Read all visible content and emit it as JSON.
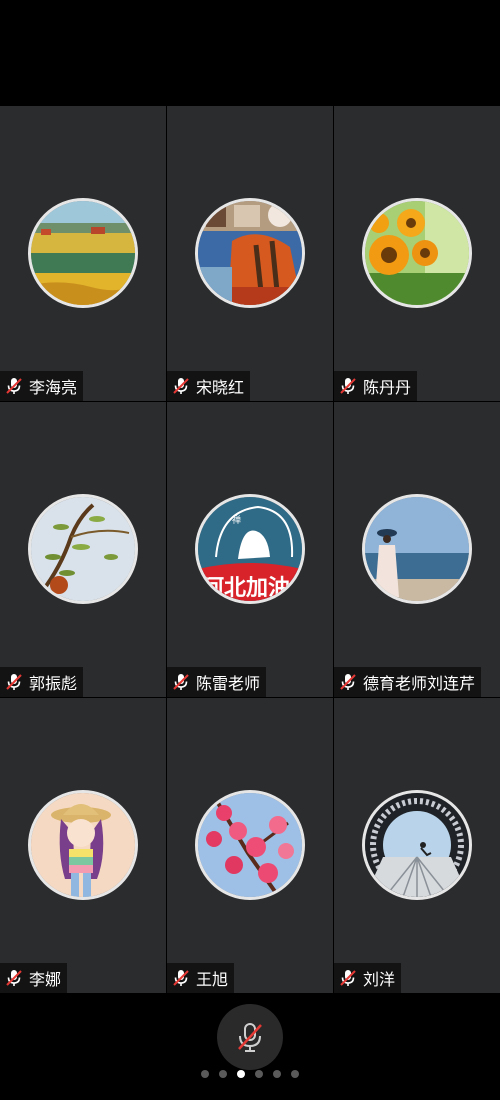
{
  "participants": [
    {
      "name": "李海亮",
      "avatar": "wheat-field-painting",
      "mic": "muted"
    },
    {
      "name": "宋晓红",
      "avatar": "autumn-collage",
      "mic": "muted"
    },
    {
      "name": "陈丹丹",
      "avatar": "sunflowers-photo",
      "mic": "muted"
    },
    {
      "name": "郭振彪",
      "avatar": "willow-branch-painting",
      "mic": "muted"
    },
    {
      "name": "陈雷老师",
      "avatar": "hebei-jiayou-logo",
      "mic": "muted"
    },
    {
      "name": "德育老师刘连芹",
      "avatar": "seaside-woman-photo",
      "mic": "muted"
    },
    {
      "name": "李娜",
      "avatar": "cartoon-girl-hat",
      "mic": "muted"
    },
    {
      "name": "王旭",
      "avatar": "pink-blossoms-photo",
      "mic": "muted"
    },
    {
      "name": "刘洋",
      "avatar": "pier-tunnel-photo",
      "mic": "muted"
    }
  ],
  "avatar_texts": {
    "logo_text": "河北加油",
    "logo_small": "禅"
  },
  "controls": {
    "mic_button_icon": "microphone-muted-icon",
    "mic_button_state": "muted"
  },
  "pager": {
    "total_pages": 6,
    "current_page": 3
  },
  "colors": {
    "tile_background": "#2b2c2e",
    "nameplate_background": "#000000",
    "mute_slash": "#e53935",
    "active_dot": "#ffffff",
    "inactive_dot": "#5a5a5a"
  }
}
